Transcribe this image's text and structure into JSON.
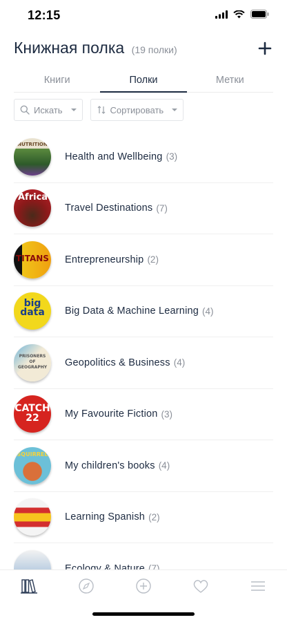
{
  "status": {
    "time": "12:15"
  },
  "header": {
    "title": "Книжная полка",
    "count": "(19 полки)",
    "add_icon": "plus-icon"
  },
  "tabs": [
    {
      "label": "Книги",
      "active": false
    },
    {
      "label": "Полки",
      "active": true
    },
    {
      "label": "Метки",
      "active": false
    }
  ],
  "filters": {
    "search_label": "Искать",
    "sort_label": "Сортировать"
  },
  "shelves": [
    {
      "name": "Health and Wellbeing",
      "count": "(3)",
      "cover_text": "NUTRITION"
    },
    {
      "name": "Travel Destinations",
      "count": "(7)",
      "cover_text": "Africa"
    },
    {
      "name": "Entrepreneurship",
      "count": "(2)",
      "cover_text": "TITANS"
    },
    {
      "name": "Big Data & Machine Learning",
      "count": "(4)",
      "cover_text": "big data"
    },
    {
      "name": "Geopolitics & Business",
      "count": "(4)",
      "cover_text": "PRISONERS OF GEOGRAPHY"
    },
    {
      "name": "My Favourite Fiction",
      "count": "(3)",
      "cover_text": "CATCH 22"
    },
    {
      "name": "My children's books",
      "count": "(4)",
      "cover_text": "SQUIRREL"
    },
    {
      "name": "Learning Spanish",
      "count": "(2)",
      "cover_text": ""
    },
    {
      "name": "Ecology & Nature",
      "count": "(7)",
      "cover_text": ""
    }
  ],
  "nav": [
    "books-icon",
    "compass-icon",
    "add-circle-icon",
    "heart-icon",
    "menu-icon"
  ],
  "colors": {
    "text": "#1c2a40",
    "muted": "#8a8f98",
    "divider": "#efefef"
  }
}
